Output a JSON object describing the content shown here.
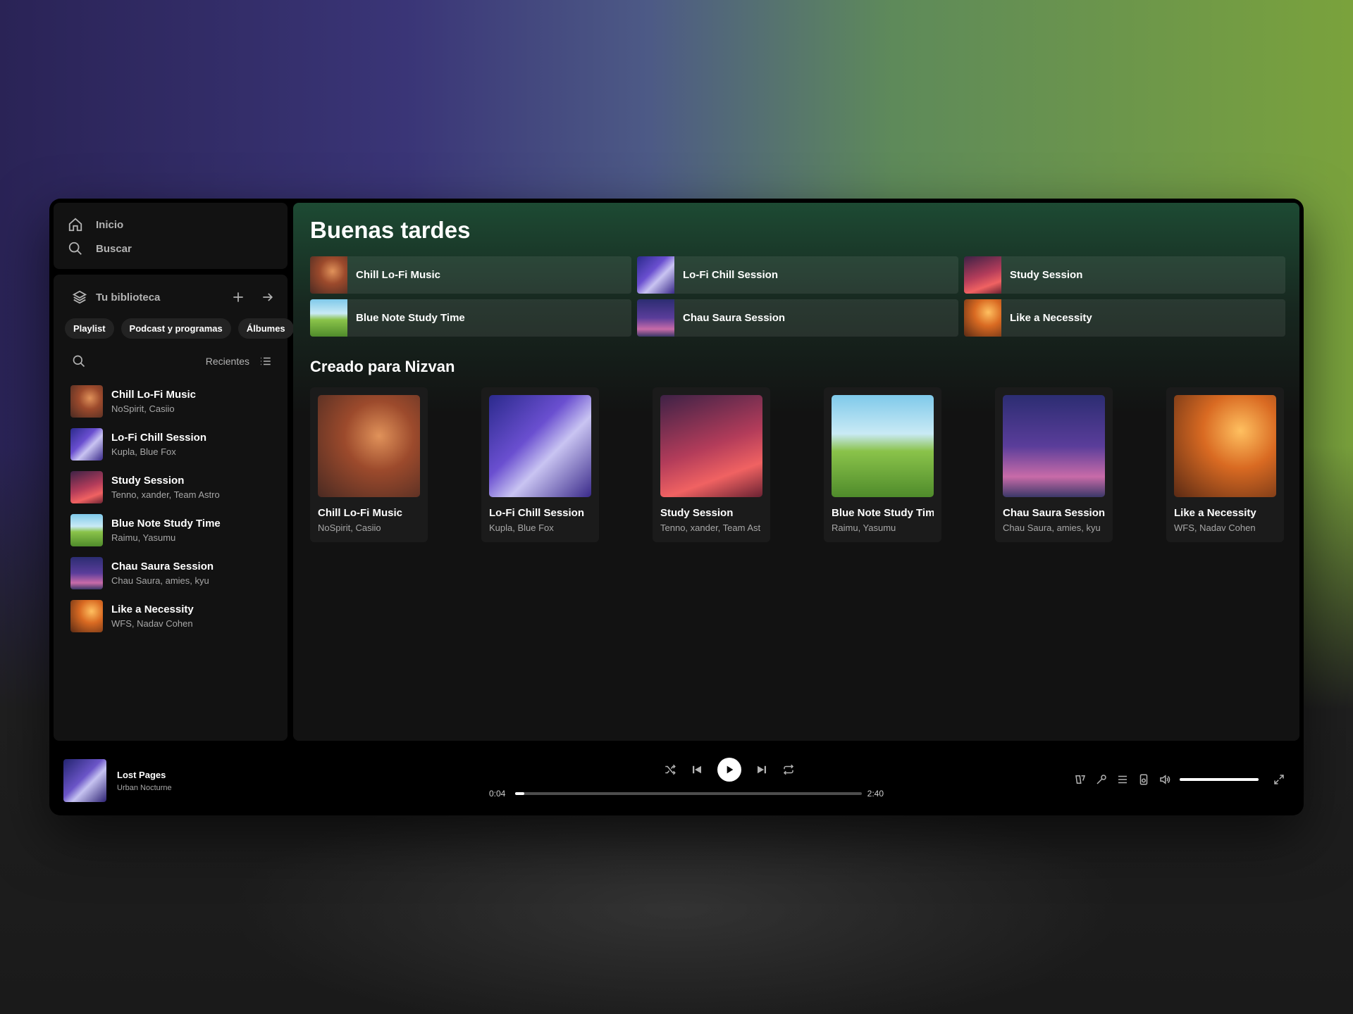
{
  "nav": {
    "home": "Inicio",
    "search": "Buscar"
  },
  "library": {
    "title": "Tu biblioteca",
    "chips": [
      "Playlist",
      "Podcast y programas",
      "Álbumes"
    ],
    "sort_label": "Recientes",
    "items": [
      {
        "title": "Chill Lo-Fi Music",
        "subtitle": "NoSpirit, Casiio"
      },
      {
        "title": "Lo-Fi Chill Session",
        "subtitle": "Kupla, Blue Fox"
      },
      {
        "title": "Study Session",
        "subtitle": "Tenno, xander, Team Astro"
      },
      {
        "title": "Blue Note Study Time",
        "subtitle": "Raimu, Yasumu"
      },
      {
        "title": "Chau Saura Session",
        "subtitle": "Chau Saura, amies, kyu"
      },
      {
        "title": "Like a Necessity",
        "subtitle": "WFS, Nadav Cohen"
      }
    ]
  },
  "main": {
    "greeting": "Buenas tardes",
    "quick": [
      "Chill Lo-Fi Music",
      "Lo-Fi Chill Session",
      "Study Session",
      "Blue Note Study Time",
      "Chau Saura Session",
      "Like a Necessity"
    ],
    "section_title": "Creado para Nizvan",
    "cards": [
      {
        "title": "Chill Lo-Fi Music",
        "subtitle": "NoSpirit, Casiio"
      },
      {
        "title": "Lo-Fi Chill Session",
        "subtitle": "Kupla, Blue Fox"
      },
      {
        "title": "Study Session",
        "subtitle": "Tenno, xander, Team Ast"
      },
      {
        "title": "Blue Note Study Tim",
        "subtitle": "Raimu, Yasumu"
      },
      {
        "title": "Chau Saura Session",
        "subtitle": "Chau Saura, amies, kyu"
      },
      {
        "title": "Like a Necessity",
        "subtitle": "WFS, Nadav Cohen"
      }
    ]
  },
  "player": {
    "track": "Lost Pages",
    "artist": "Urban Nocturne",
    "elapsed": "0:04",
    "duration": "2:40",
    "progress_fraction": 0.025,
    "volume_fraction": 1.0
  },
  "colors": {
    "accent": "#1ed760",
    "panel": "#121212",
    "text_secondary": "#a7a7a7"
  }
}
